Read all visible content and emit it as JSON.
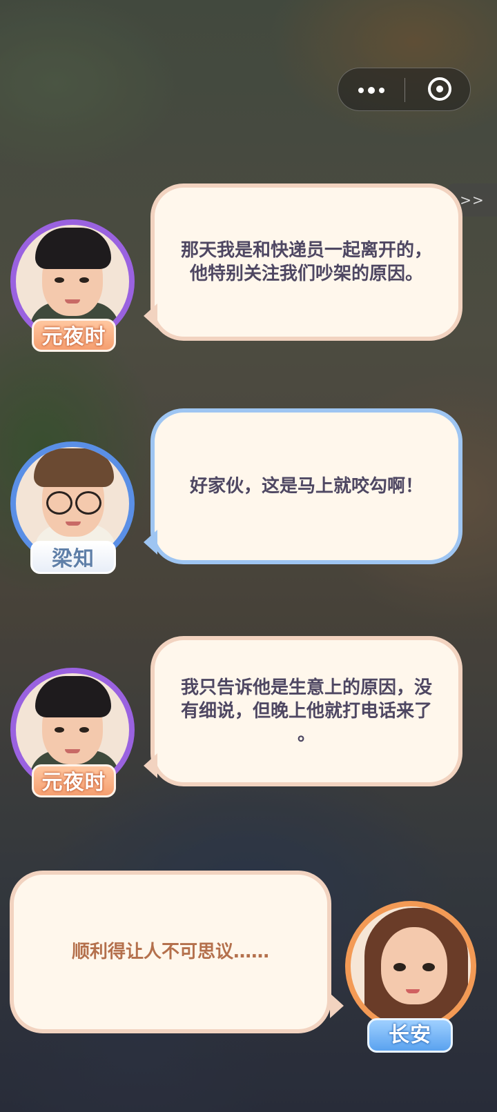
{
  "capsule": {
    "more_icon": "more-dots-icon",
    "close_icon": "target-icon"
  },
  "skip_button": {
    "label": ">>"
  },
  "dialogues": [
    {
      "speaker": "元夜时",
      "text_lines": [
        "那天我是和快递员一起离开的，",
        "他特别关注我们吵架的原因。"
      ]
    },
    {
      "speaker": "梁知",
      "text_lines": [
        "好家伙，这是马上就咬勾啊！"
      ]
    },
    {
      "speaker": "元夜时",
      "text_lines": [
        "我只告诉他是生意上的原因，没",
        "有细说，但晚上他就打电话来了",
        "。"
      ]
    },
    {
      "speaker": "长安",
      "text_lines": [
        "顺利得让人不可思议……"
      ]
    }
  ],
  "colors": {
    "purple_ring": "#9a62e0",
    "blue_ring": "#5a8fe6",
    "orange_ring": "#f39a55",
    "bubble_fill": "#fff7ec"
  }
}
